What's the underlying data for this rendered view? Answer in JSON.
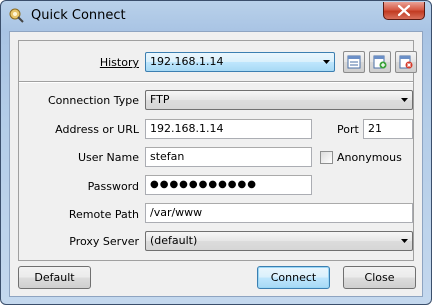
{
  "window": {
    "title": "Quick Connect",
    "app_icon": "quick-connect-icon",
    "close_icon": "close-icon"
  },
  "history": {
    "label": "History",
    "value": "192.168.1.14",
    "buttons": [
      "bookmark-icon",
      "add-bookmark-icon",
      "delete-bookmark-icon"
    ]
  },
  "connection_type": {
    "label": "Connection Type",
    "value": "FTP"
  },
  "address": {
    "label": "Address or URL",
    "value": "192.168.1.14"
  },
  "port": {
    "label": "Port",
    "value": "21"
  },
  "user_name": {
    "label": "User Name",
    "value": "stefan"
  },
  "anonymous": {
    "label": "Anonymous",
    "checked": false
  },
  "password": {
    "label": "Password",
    "masked": "●●●●●●●●●●●"
  },
  "remote_path": {
    "label": "Remote Path",
    "value": "/var/www"
  },
  "proxy_server": {
    "label": "Proxy Server",
    "value": "(default)"
  },
  "buttons": {
    "default": "Default",
    "connect": "Connect",
    "close": "Close"
  },
  "colors": {
    "accent": "#3c7fb1",
    "close_red": "#c23b22",
    "title_bar": "#b9d1ea"
  }
}
